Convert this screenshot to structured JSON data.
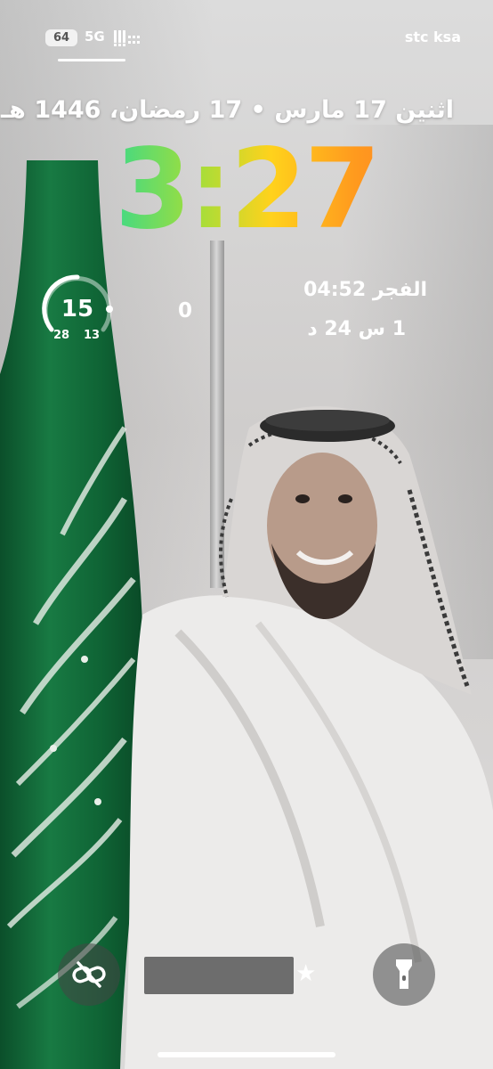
{
  "status_bar": {
    "battery_level": "64",
    "network_type": "5G",
    "carrier": "stc ksa",
    "icons": [
      "signal-icon"
    ]
  },
  "lock_screen": {
    "date_line": "اثنين 17 مارس • 17 رمضان، 1446 هـ",
    "time": "3:27",
    "clock_colors": [
      "#3fc7e6",
      "#39d98a",
      "#a3de3a",
      "#ffd21c",
      "#ff9a1e",
      "#ff6b2a"
    ]
  },
  "widgets": {
    "temperature_gauge": {
      "value": "15",
      "low": "13",
      "high": "28"
    },
    "counter": {
      "value": "0"
    },
    "prayer": {
      "line": "الفجر 04:52",
      "countdown": "1 س 24 د"
    }
  },
  "controls": {
    "left_icon": "link-off-icon",
    "right_icon": "flashlight-icon",
    "middle_icon": "star-icon"
  }
}
